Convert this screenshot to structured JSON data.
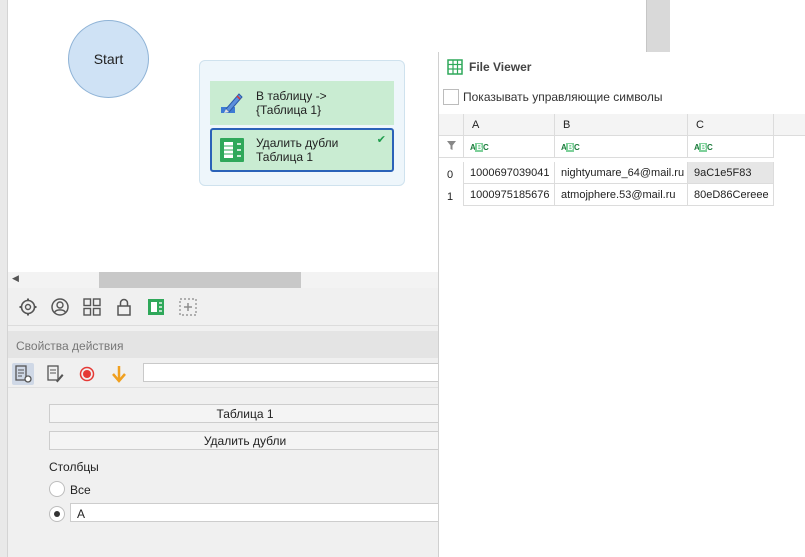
{
  "workflow": {
    "start_label": "Start",
    "action1": {
      "line1": "В таблицу ->",
      "line2": "{Таблица 1}"
    },
    "action2": {
      "line1": "Удалить дубли",
      "line2": "Таблица 1",
      "status": "✔"
    }
  },
  "props": {
    "header": "Свойства действия",
    "table_value": "Таблица 1",
    "action_value": "Удалить дубли",
    "columns_label": "Столбцы",
    "option_all": "Все",
    "column_value": "A",
    "selected_option": "column"
  },
  "file_viewer": {
    "title": "File Viewer",
    "show_control_chars": "Показывать управляющие символы",
    "columns": [
      "A",
      "B",
      "C"
    ],
    "type_badge": "ABC",
    "rows": [
      {
        "index": "0",
        "cells": [
          "1000697039041",
          "nightyumare_64@mail.ru",
          "9aC1e5F83"
        ]
      },
      {
        "index": "1",
        "cells": [
          "1000975185676",
          "atmojphere.53@mail.ru",
          "80eD86Cereee"
        ]
      }
    ]
  },
  "colors": {
    "node_fill": "#cfe2f5",
    "action_fill": "#c9ecd2",
    "selected_border": "#2a62b8",
    "record": "#e53935",
    "arrow": "#f0a020"
  }
}
